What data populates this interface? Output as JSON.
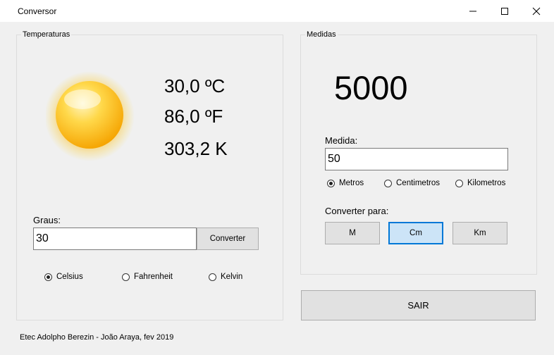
{
  "window": {
    "title": "Conversor"
  },
  "temperaturas": {
    "legend": "Temperaturas",
    "celsius": "30,0 ºC",
    "fahrenheit": "86,0 ºF",
    "kelvin": "303,2 K",
    "graus_label": "Graus:",
    "graus_value": "30",
    "converter_label": "Converter",
    "options": [
      {
        "label": "Celsius",
        "selected": true
      },
      {
        "label": "Fahrenheit",
        "selected": false
      },
      {
        "label": "Kelvin",
        "selected": false
      }
    ]
  },
  "medidas": {
    "legend": "Medidas",
    "result": "5000",
    "medida_label": "Medida:",
    "medida_value": "50",
    "options": [
      {
        "label": "Metros",
        "selected": true
      },
      {
        "label": "Centimetros",
        "selected": false
      },
      {
        "label": "Kilometros",
        "selected": false
      }
    ],
    "converter_para_label": "Converter para:",
    "buttons": [
      {
        "label": "M",
        "selected": false
      },
      {
        "label": "Cm",
        "selected": true
      },
      {
        "label": "Km",
        "selected": false
      }
    ]
  },
  "sair_label": "SAIR",
  "footer": "Etec Adolpho Berezin - João Araya, fev 2019",
  "icons": [
    "sun-icon",
    "minimize-icon",
    "maximize-icon",
    "close-icon"
  ],
  "colors": {
    "selected_button_bg": "#cce4f7",
    "selected_button_border": "#0078d7",
    "sun": "#ffc21a"
  }
}
